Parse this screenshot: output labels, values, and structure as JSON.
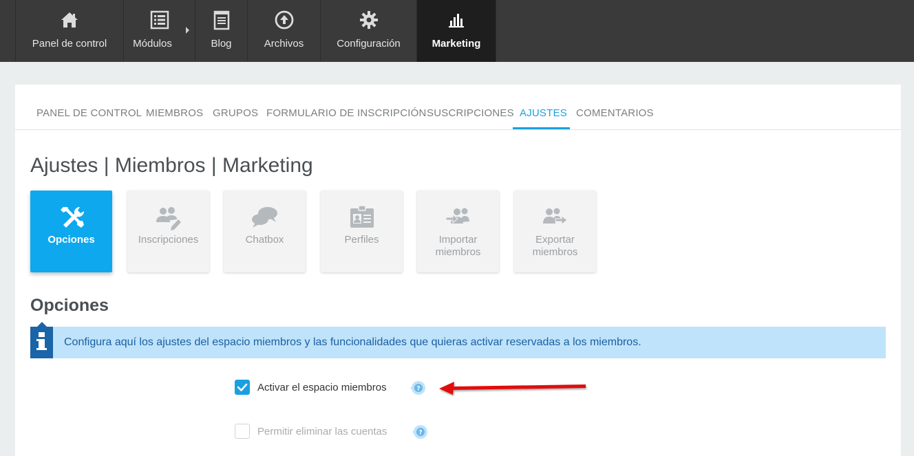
{
  "topnav": {
    "items": [
      {
        "label": "Panel de control",
        "icon": "home-icon"
      },
      {
        "label": "Módulos",
        "icon": "list-icon"
      },
      {
        "label": "Blog",
        "icon": "blog-icon"
      },
      {
        "label": "Archivos",
        "icon": "upload-icon"
      },
      {
        "label": "Configuración",
        "icon": "gear-icon"
      },
      {
        "label": "Marketing",
        "icon": "bar-chart-icon"
      }
    ],
    "active": "Marketing"
  },
  "tabs": {
    "items": [
      {
        "label": "PANEL DE CONTROL"
      },
      {
        "label": "MIEMBROS"
      },
      {
        "label": "GRUPOS"
      },
      {
        "label": "FORMULARIO DE INSCRIPCIÓN"
      },
      {
        "label": "SUSCRIPCIONES"
      },
      {
        "label": "AJUSTES"
      },
      {
        "label": "COMENTARIOS"
      }
    ],
    "active": "AJUSTES"
  },
  "page_title": "Ajustes | Miembros | Marketing",
  "tiles": {
    "items": [
      {
        "label": "Opciones",
        "icon": "tools-icon"
      },
      {
        "label": "Inscripciones",
        "icon": "users-edit-icon"
      },
      {
        "label": "Chatbox",
        "icon": "chat-bubbles-icon"
      },
      {
        "label": "Perfiles",
        "icon": "id-card-icon"
      },
      {
        "label": "Importar miembros",
        "icon": "users-import-icon"
      },
      {
        "label": "Exportar miembros",
        "icon": "users-export-icon"
      }
    ],
    "active": "Opciones"
  },
  "section_title": "Opciones",
  "info": {
    "text": "Configura aquí los ajustes del espacio miembros y las funcionalidades que quieras activar reservadas a los miembros."
  },
  "options": [
    {
      "label": "Activar el espacio miembros",
      "checked": true
    },
    {
      "label": "Permitir eliminar las cuentas",
      "checked": false
    }
  ],
  "colors": {
    "accent": "#1aa0e0",
    "topnav_bg": "#3a3a3a",
    "info_bg": "#bfe3fa",
    "info_bar": "#1a64a8",
    "annotation_arrow": "#e01010"
  }
}
